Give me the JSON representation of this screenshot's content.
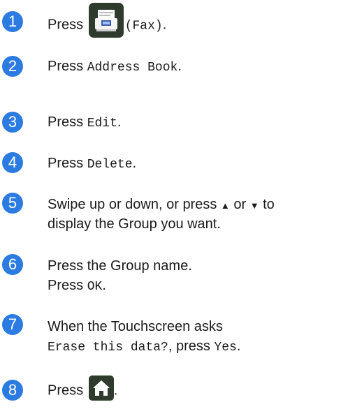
{
  "steps": [
    {
      "num": "1",
      "t1": "Press ",
      "t2": "(Fax)",
      "t3": "."
    },
    {
      "num": "2",
      "t1": "Press ",
      "code": "Address Book",
      "t2": "."
    },
    {
      "num": "3",
      "t1": "Press ",
      "code": "Edit",
      "t2": "."
    },
    {
      "num": "4",
      "t1": "Press ",
      "code": "Delete",
      "t2": "."
    },
    {
      "num": "5",
      "l1a": "Swipe up or down, or press ",
      "up": "▲",
      "l1b": " or ",
      "down": "▼",
      "l1c": " to",
      "l2": "display the Group you want."
    },
    {
      "num": "6",
      "l1": "Press the Group name.",
      "l2a": "Press ",
      "l2code": "OK",
      "l2b": "."
    },
    {
      "num": "7",
      "l1": "When the Touchscreen asks",
      "l2code": "Erase this data?",
      "l2a": ", press ",
      "l2code2": "Yes",
      "l2b": "."
    },
    {
      "num": "8",
      "t1": "Press ",
      "t2": "."
    }
  ],
  "icons": {
    "fax": "fax-icon",
    "home": "home-icon"
  },
  "colors": {
    "badge": "#2b7be0",
    "icon_bg": "#2e3b2d"
  }
}
